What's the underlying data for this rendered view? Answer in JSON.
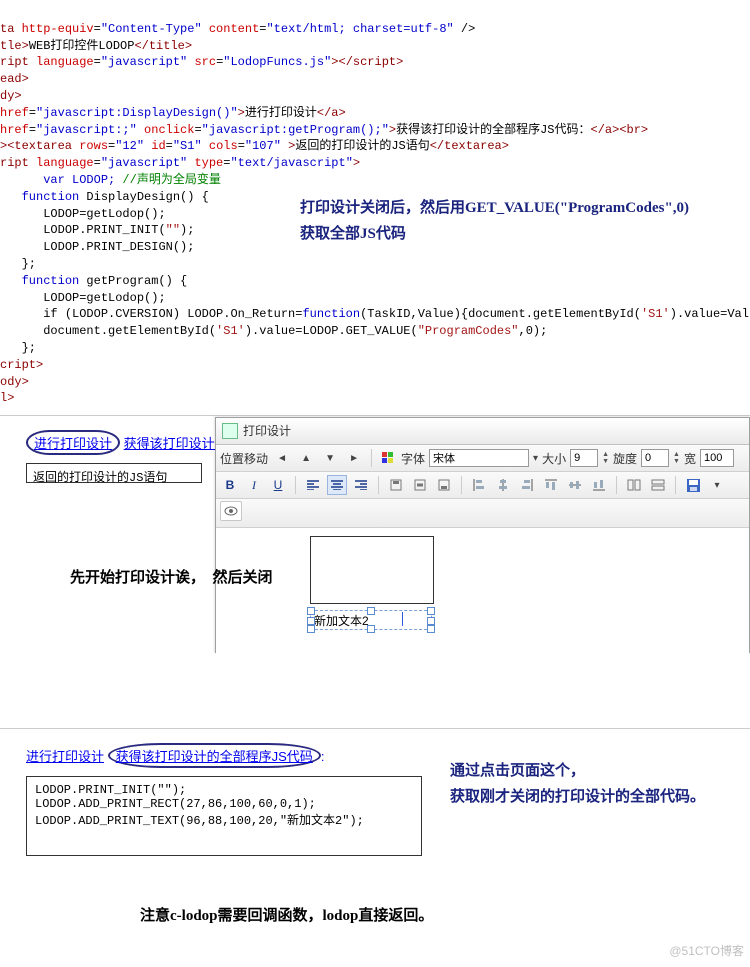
{
  "code": {
    "meta_attr": "http-equiv",
    "meta_val1": "\"Content-Type\"",
    "meta_attr2": "content",
    "meta_val2": "\"text/html; charset=utf-8\"",
    "title_text": "WEB打印控件LODOP",
    "script_lang_label": "language",
    "script_lang_val": "\"javascript\"",
    "script_src_label": "src",
    "script_src_val": "\"LodopFuncs.js\"",
    "a1_href": "\"javascript:DisplayDesign()\"",
    "a1_text": "进行打印设计",
    "a2_href": "\"javascript:;\"",
    "a2_onclick_attr": "onclick",
    "a2_onclick_val": "\"javascript:getProgram();\"",
    "a2_text": "获得该打印设计的全部程序JS代码：",
    "ta_rows": "\"12\"",
    "ta_id": "\"S1\"",
    "ta_cols": "\"107\"",
    "ta_text": "返回的打印设计的JS语句",
    "script_type_val": "\"text/javascript\"",
    "var_decl": "var LODOP;",
    "var_cmt": " //声明为全局变量",
    "fn1": "function DisplayDesign() {",
    "fn1_b1": "LODOP=getLodop();",
    "fn1_b2": "LODOP.PRINT_INIT(\"\");",
    "fn1_b3": "LODOP.PRINT_DESIGN();",
    "brace_close": "};",
    "fn2": "function getProgram() {",
    "fn2_b1": "LODOP=getLodop();",
    "fn2_b2a": "if (LODOP.CVERSION) LODOP.On_Return=",
    "fn2_b2_kw": "function",
    "fn2_b2b": "(TaskID,Value){document.getElementById(",
    "fn2_s1": "'S1'",
    "fn2_b2c": ").value=Value;}",
    "fn2_b3a": "document.getElementById(",
    "fn2_b3b": ").value=LODOP.GET_VALUE(",
    "fn2_s2": "\"ProgramCodes\"",
    "fn2_b3c": ",0);"
  },
  "note1_line1": "打印设计关闭后，然后用GET_VALUE(\"ProgramCodes\",0)",
  "note1_line2": "获取全部JS代码",
  "links": {
    "design": "进行打印设计",
    "getcode": "获得该打印设计的全部程序JS代码：",
    "getcode2": "获得该打印设计的全部程序JS代码"
  },
  "textarea1_text": "返回的打印设计的JS语句",
  "dialog": {
    "title": "打印设计",
    "pos_move": "位置移动",
    "font_label": "字体",
    "font_value": "宋体",
    "size_label": "大小",
    "size_value": "9",
    "rotate_label": "旋度",
    "rotate_value": "0",
    "width_label": "宽",
    "width_value": "100",
    "bold": "B",
    "italic": "I",
    "underline": "U",
    "text_obj": "新加文本2"
  },
  "caption2_a": "先开始打印设计诶，",
  "caption2_b": "然后关闭",
  "note2_line1": "通过点击页面这个，",
  "note2_line2": "获取刚才关闭的打印设计的全部代码。",
  "result_code_l1": "LODOP.PRINT_INIT(\"\");",
  "result_code_l2": "LODOP.ADD_PRINT_RECT(27,86,100,60,0,1);",
  "result_code_l3": "LODOP.ADD_PRINT_TEXT(96,88,100,20,\"新加文本2\");",
  "caption3": "注意c-lodop需要回调函数，lodop直接返回。",
  "watermark": "@51CTO博客"
}
